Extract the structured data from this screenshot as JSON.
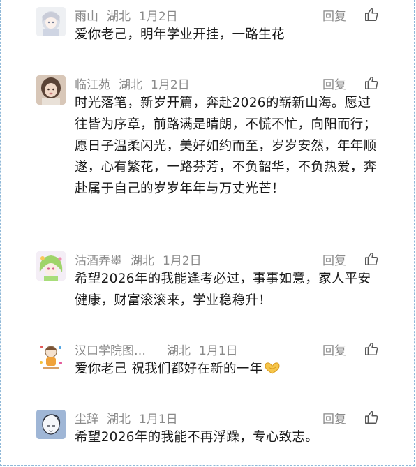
{
  "comments": [
    {
      "name": "雨山",
      "location": "湖北",
      "date": "1月2日",
      "reply_label": "回复",
      "text": "爱你老己，明年学业开挂，一路生花",
      "avatar_icon": "anime-girl-avatar-icon"
    },
    {
      "name": "临江苑",
      "location": "湖北",
      "date": "1月2日",
      "reply_label": "回复",
      "text": "时光落笔，新岁开篇，奔赴2026的崭新山海。愿过往皆为序章，前路满是晴朗，不慌不忙，向阳而行；愿日子温柔闪光，美好如约而至，岁岁安然，年年顺遂，心有繁花，一路芬芳，不负韶华，不负热爱，奔赴属于自己的岁岁年年与万丈光芒！",
      "avatar_icon": "photo-avatar-icon"
    },
    {
      "name": "沽酒弄墨",
      "location": "湖北",
      "date": "1月2日",
      "reply_label": "回复",
      "text": "希望2026年的我能逢考必过，事事如意，家人平安健康，财富滚滚来，学业稳稳升！",
      "avatar_icon": "green-hair-character-avatar-icon"
    },
    {
      "name": "汉口学院图…",
      "location": "湖北",
      "date": "1月1日",
      "reply_label": "回复",
      "text": "爱你老己 祝我们都好在新的一年",
      "avatar_icon": "cartoon-avatar-icon",
      "emoji": "heart-hands-emoji"
    },
    {
      "name": "尘辞",
      "location": "湖北",
      "date": "1月1日",
      "reply_label": "回复",
      "text": "希望2026年的我能不再浮躁，专心致志。",
      "avatar_icon": "sketch-avatar-icon"
    }
  ]
}
